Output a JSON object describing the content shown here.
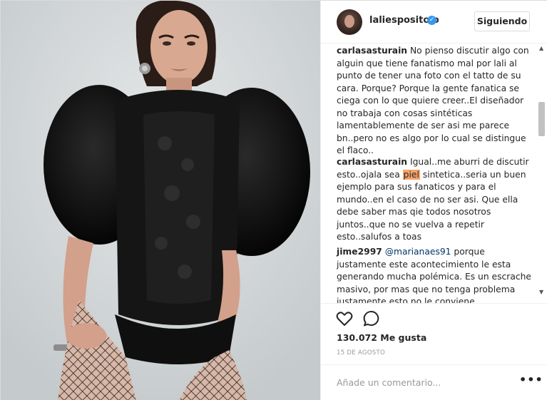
{
  "post": {
    "username": "laliesposito o",
    "follow_label": "Siguiendo",
    "likes": "130.072 Me gusta",
    "date": "15 DE AGOSTO",
    "add_comment_placeholder": "Añade un comentario...",
    "more_icon": "•••"
  },
  "comments": [
    {
      "author": "carlasasturain",
      "text": " No pienso discutir algo con alguin que tiene fanatismo mal por lali al punto de tener una foto con el tatto de su cara. Porque? Porque la gente fanatica se ciega con lo que quiere creer..El diseñador no trabaja con cosas sintéticas lamentablemente de ser asi me parece bn..pero no es algo por lo cual se distingue el flaco.."
    },
    {
      "author": "carlasasturain",
      "text_before": " Igual..me aburri de discutir esto..ojala sea ",
      "highlight": "piel",
      "text_after": " sintetica..seria un buen ejemplo para sus fanaticos y para el mundo..en el caso de no ser asi. Que ella debe saber mas qie todos nosotros juntos..que no se vuelva a repetir esto..salufos a toas"
    },
    {
      "author": "jime2997",
      "mention": "@marianaes91",
      "text": " porque justamente este acontecimiento le esta generando mucha polémica. Es un escrache masivo, por mas que no tenga problema justamente esto no le conviene."
    }
  ],
  "icons": {
    "verified": "verified-badge-icon",
    "like": "heart-icon",
    "comment": "comment-bubble-icon",
    "scroll_up": "▲",
    "scroll_down": "▼",
    "checkmark": "✓"
  },
  "colors": {
    "highlight": "#f6a36a",
    "verified": "#3897f0",
    "mention": "#003569"
  }
}
